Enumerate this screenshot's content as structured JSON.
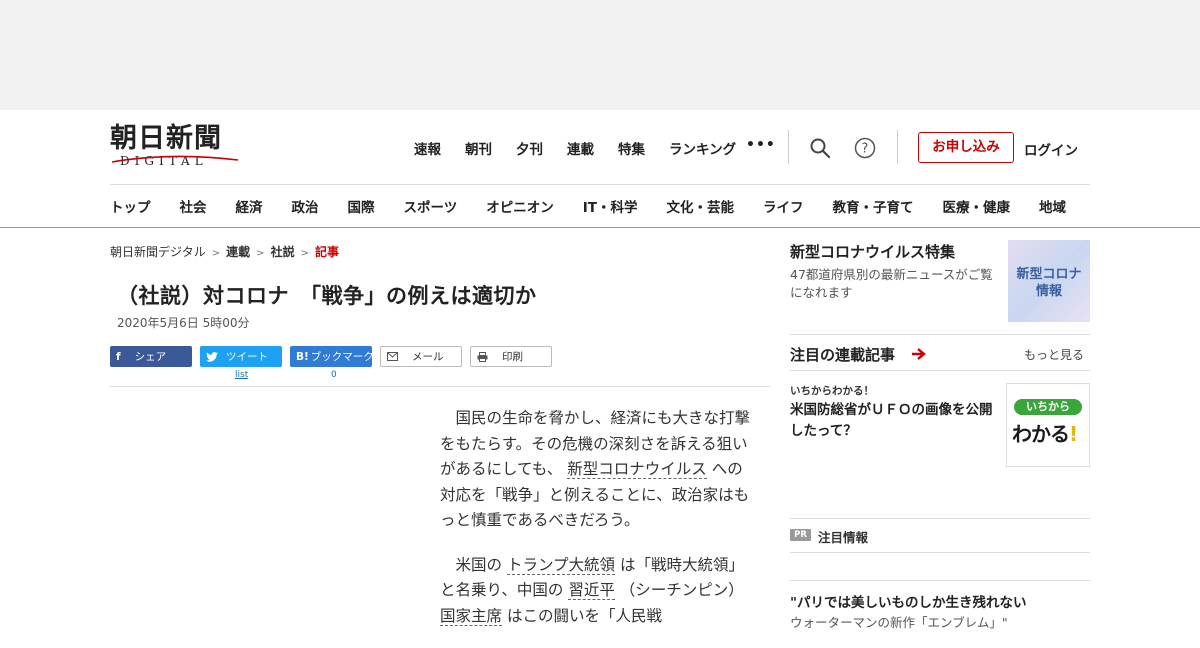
{
  "logo": {
    "main": "朝日新聞",
    "sub": "DIGITAL"
  },
  "topnav": [
    "速報",
    "朝刊",
    "夕刊",
    "連載",
    "特集",
    "ランキング"
  ],
  "more_dots": "•••",
  "header": {
    "apply_label": "お申し込み",
    "login_label": "ログイン"
  },
  "catnav": [
    "トップ",
    "社会",
    "経済",
    "政治",
    "国際",
    "スポーツ",
    "オピニオン",
    "IT・科学",
    "文化・芸能",
    "ライフ",
    "教育・子育て",
    "医療・健康",
    "地域"
  ],
  "breadcrumb": [
    "朝日新聞デジタル",
    "連載",
    "社説",
    "記事"
  ],
  "article": {
    "title": "（社説）対コロナ　「戦争」の例えは適切か",
    "date": "2020年5月6日 5時00分",
    "share": {
      "facebook": "シェア",
      "twitter": "ツイート",
      "hatena": "ブックマーク",
      "hatena_mark": "B!",
      "mail": "メール",
      "print": "印刷"
    },
    "twitter_count": "list",
    "hatena_count": "0",
    "p1": {
      "a": "国民の生命を脅かし、経済にも大きな打撃をもたらす。その危機の深刻さを訴える狙いがあるにしても、",
      "kw1": "新型コロナウイルス",
      "b": "への対応を「戦争」と例えることに、政治家はもっと慎重であるべきだろう。"
    },
    "p2": {
      "a": "米国の",
      "kw1": "トランプ大統領",
      "b": "は「戦時大統領」と名乗り、中国の",
      "kw2": "習近平",
      "c": "（シーチンピン）",
      "kw3": "国家主席",
      "d": "はこの闘いを「人民戦"
    }
  },
  "sidebar": {
    "corona": {
      "heading": "新型コロナウイルス特集",
      "desc": "47都道府県別の最新ニュースがご覧になれます",
      "image_text_1": "新型コロナ",
      "image_text_2": "情報"
    },
    "rensai": {
      "heading": "注目の連載記事",
      "more": "もっと見る",
      "kicker": "いちからわかる！",
      "title": "米国防総省がＵＦＯの画像を公開したって？",
      "badge_top": "いちから",
      "badge_main": "わかる",
      "badge_excl": "!"
    },
    "pr": {
      "badge": "PR",
      "heading": "注目情報",
      "title": "\"パリでは美しいものしか生き残れない",
      "sub": "ウォーターマンの新作「エンブレム」\""
    }
  },
  "colors": {
    "accent_red": "#cc0000",
    "facebook": "#3b5998",
    "twitter": "#1da1f2",
    "hatena": "#2f7bd6"
  }
}
